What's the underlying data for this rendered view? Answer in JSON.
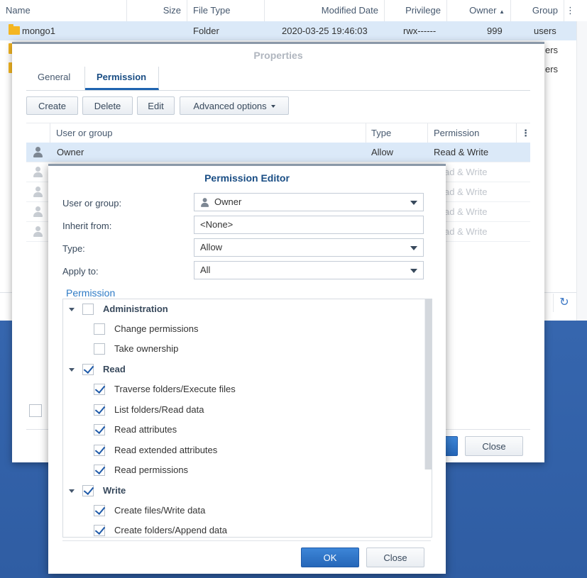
{
  "file_list": {
    "columns": [
      "Name",
      "Size",
      "File Type",
      "Modified Date",
      "Privilege",
      "Owner",
      "Group"
    ],
    "sort_indicator": "▲",
    "menu_glyph": "⋮",
    "rows": [
      {
        "name": "mongo1",
        "size": "",
        "type": "Folder",
        "modified": "2020-03-25 19:46:03",
        "privilege": "rwx------",
        "owner": "999",
        "group": "users"
      },
      {
        "group_partial": "ers"
      },
      {
        "group_partial": "ers"
      }
    ],
    "refresh_glyph": "↻"
  },
  "properties": {
    "title": "Properties",
    "tabs": [
      "General",
      "Permission"
    ],
    "active_tab": "Permission",
    "toolbar": {
      "create": "Create",
      "delete": "Delete",
      "edit": "Edit",
      "advanced": "Advanced options"
    },
    "table": {
      "headers": {
        "user": "User or group",
        "type": "Type",
        "permission": "Permission"
      },
      "menu_glyph": "⋮",
      "rows": [
        {
          "user": "Owner",
          "type": "Allow",
          "permission": "Read & Write"
        },
        {
          "permission_partial": "ad & Write"
        },
        {
          "permission_partial": "ad & Write"
        },
        {
          "permission_partial": "ad & Write"
        },
        {
          "permission_partial": "ad & Write"
        }
      ]
    },
    "buttons": {
      "close": "Close"
    }
  },
  "editor": {
    "title": "Permission Editor",
    "fields": {
      "user_label": "User or group:",
      "user_value": "Owner",
      "inherit_label": "Inherit from:",
      "inherit_value": "<None>",
      "type_label": "Type:",
      "type_value": "Allow",
      "apply_label": "Apply to:",
      "apply_value": "All"
    },
    "permission_section": "Permission",
    "tree": [
      {
        "label": "Administration",
        "level": 0,
        "checked": false
      },
      {
        "label": "Change permissions",
        "level": 1,
        "checked": false
      },
      {
        "label": "Take ownership",
        "level": 1,
        "checked": false
      },
      {
        "label": "Read",
        "level": 0,
        "checked": true
      },
      {
        "label": "Traverse folders/Execute files",
        "level": 1,
        "checked": true
      },
      {
        "label": "List folders/Read data",
        "level": 1,
        "checked": true
      },
      {
        "label": "Read attributes",
        "level": 1,
        "checked": true
      },
      {
        "label": "Read extended attributes",
        "level": 1,
        "checked": true
      },
      {
        "label": "Read permissions",
        "level": 1,
        "checked": true
      },
      {
        "label": "Write",
        "level": 0,
        "checked": true
      },
      {
        "label": "Create files/Write data",
        "level": 1,
        "checked": true
      },
      {
        "label": "Create folders/Append data",
        "level": 1,
        "checked": true
      }
    ],
    "buttons": {
      "ok": "OK",
      "close": "Close"
    }
  },
  "colors": {
    "accent": "#2566b8",
    "selection": "#dbe9f8",
    "folder": "#f4b622",
    "desktop": "#3d6cb0"
  }
}
